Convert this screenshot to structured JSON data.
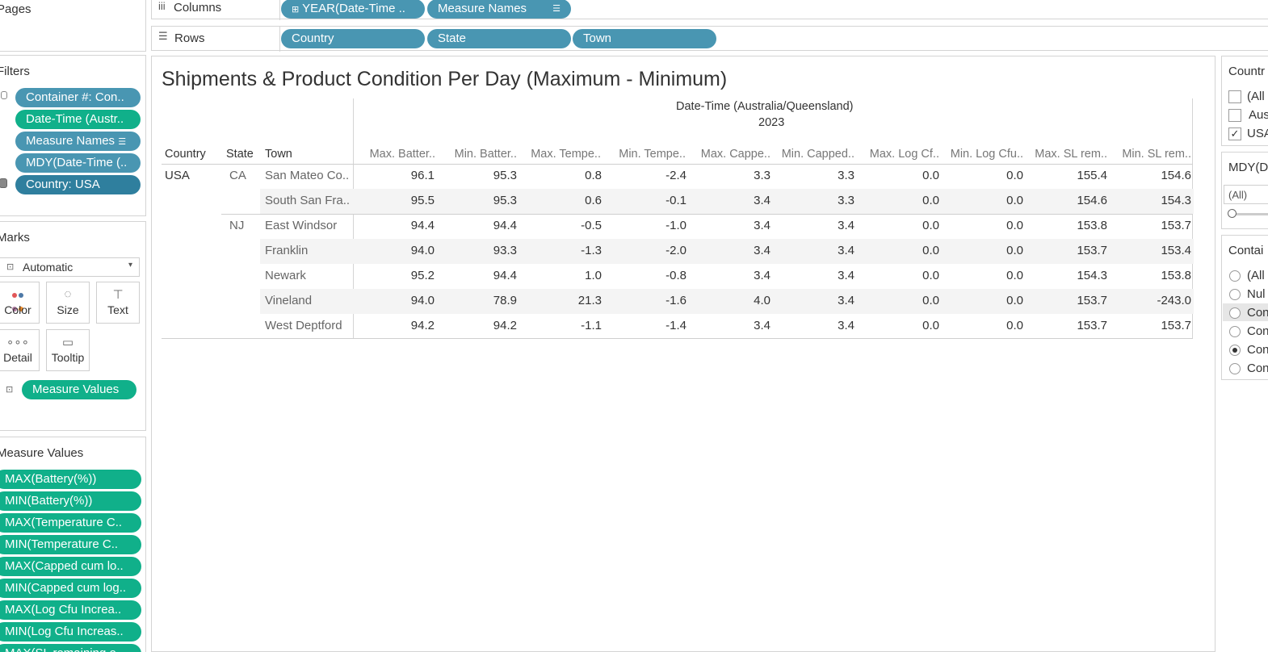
{
  "shelves": {
    "pages_label": "Pages",
    "columns_label": "Columns",
    "rows_label": "Rows",
    "column_pills": [
      "YEAR(Date-Time ..",
      "Measure Names"
    ],
    "row_pills": [
      "Country",
      "State",
      "Town"
    ]
  },
  "filters": {
    "label": "Filters",
    "items": [
      "Container #: Con..",
      "Date-Time (Austr..",
      "Measure Names",
      "MDY(Date-Time (..",
      "Country: USA"
    ]
  },
  "marks": {
    "label": "Marks",
    "type": "Automatic",
    "buttons": [
      "Color",
      "Size",
      "Text",
      "Detail",
      "Tooltip"
    ],
    "text_pill": "Measure Values"
  },
  "measure_values": {
    "label": "Measure Values",
    "items": [
      "MAX(Battery(%))",
      "MIN(Battery(%))",
      "MAX(Temperature C..",
      "MIN(Temperature C..",
      "MAX(Capped cum lo..",
      "MIN(Capped cum log..",
      "MAX(Log Cfu Increa..",
      "MIN(Log Cfu Increas..",
      "MAX(SL remaining o.."
    ]
  },
  "viz": {
    "title": "Shipments & Product Condition Per Day (Maximum - Minimum)",
    "date_header": "Date-Time (Australia/Queensland)",
    "year": "2023",
    "row_headers": [
      "Country",
      "State",
      "Town"
    ],
    "columns": [
      "Max. Batter..",
      "Min. Batter..",
      "Max. Tempe..",
      "Min. Tempe..",
      "Max. Cappe..",
      "Min. Capped..",
      "Max. Log Cf..",
      "Min. Log Cfu..",
      "Max. SL rem..",
      "Min. SL rem.."
    ],
    "rows": [
      {
        "country": "USA",
        "state": "CA",
        "town": "San Mateo Co..",
        "values": [
          "96.1",
          "95.3",
          "0.8",
          "-2.4",
          "3.3",
          "3.3",
          "0.0",
          "0.0",
          "155.4",
          "154.6"
        ]
      },
      {
        "country": "",
        "state": "",
        "town": "South San Fra..",
        "values": [
          "95.5",
          "95.3",
          "0.6",
          "-0.1",
          "3.4",
          "3.3",
          "0.0",
          "0.0",
          "154.6",
          "154.3"
        ]
      },
      {
        "country": "",
        "state": "NJ",
        "town": "East Windsor",
        "values": [
          "94.4",
          "94.4",
          "-0.5",
          "-1.0",
          "3.4",
          "3.4",
          "0.0",
          "0.0",
          "153.8",
          "153.7"
        ]
      },
      {
        "country": "",
        "state": "",
        "town": "Franklin",
        "values": [
          "94.0",
          "93.3",
          "-1.3",
          "-2.0",
          "3.4",
          "3.4",
          "0.0",
          "0.0",
          "153.7",
          "153.4"
        ]
      },
      {
        "country": "",
        "state": "",
        "town": "Newark",
        "values": [
          "95.2",
          "94.4",
          "1.0",
          "-0.8",
          "3.4",
          "3.4",
          "0.0",
          "0.0",
          "154.3",
          "153.8"
        ]
      },
      {
        "country": "",
        "state": "",
        "town": "Vineland",
        "values": [
          "94.0",
          "78.9",
          "21.3",
          "-1.6",
          "4.0",
          "3.4",
          "0.0",
          "0.0",
          "153.7",
          "-243.0"
        ]
      },
      {
        "country": "",
        "state": "",
        "town": "West Deptford",
        "values": [
          "94.2",
          "94.2",
          "-1.1",
          "-1.4",
          "3.4",
          "3.4",
          "0.0",
          "0.0",
          "153.7",
          "153.7"
        ]
      }
    ]
  },
  "right_cards": {
    "country": {
      "title": "Countr",
      "options": [
        "(All",
        "Aus",
        "USA"
      ],
      "checked": [
        false,
        false,
        true
      ]
    },
    "mdy": {
      "title": "MDY(D",
      "select_value": "(All)"
    },
    "container": {
      "title": "Contai",
      "options": [
        "(All",
        "Nul",
        "Con",
        "Con",
        "Con",
        "Con"
      ],
      "selected_index": 4
    }
  },
  "colors": {
    "pill_blue": "#4996b2",
    "pill_green": "#10b08a",
    "pill_dark": "#2f7f9e"
  }
}
